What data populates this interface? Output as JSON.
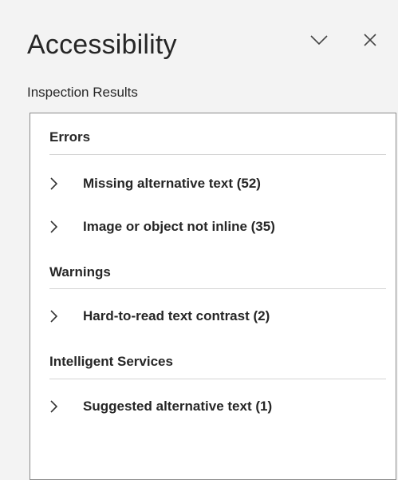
{
  "pane": {
    "title": "Accessibility",
    "collapse_icon": "chevron-down-icon",
    "close_icon": "close-icon"
  },
  "inspection_results_label": "Inspection Results",
  "groups": [
    {
      "heading": "Errors",
      "items": [
        {
          "label": "Missing alternative text (52)",
          "icon": "chevron-right-icon"
        },
        {
          "label": "Image or object not inline (35)",
          "icon": "chevron-right-icon"
        }
      ]
    },
    {
      "heading": "Warnings",
      "items": [
        {
          "label": "Hard-to-read text contrast (2)",
          "icon": "chevron-right-icon"
        }
      ]
    },
    {
      "heading": "Intelligent Services",
      "items": [
        {
          "label": "Suggested alternative text (1)",
          "icon": "chevron-right-icon"
        }
      ]
    }
  ],
  "colors": {
    "pane_background": "#f3f3f3",
    "results_background": "#ffffff",
    "text": "#262626",
    "border": "#8a8a8a",
    "divider": "#d4d4d4"
  }
}
